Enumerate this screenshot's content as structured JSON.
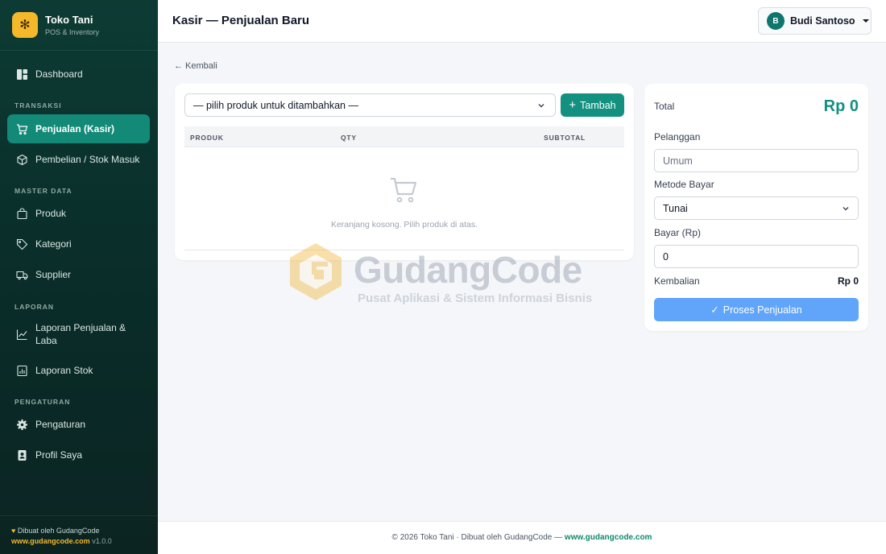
{
  "brand": {
    "name": "Toko Tani",
    "subtitle": "POS & Inventory"
  },
  "sidebar": {
    "dashboard": "Dashboard",
    "sections": {
      "transaksi": "TRANSAKSI",
      "master": "MASTER DATA",
      "laporan": "LAPORAN",
      "pengaturan": "PENGATURAN"
    },
    "items": {
      "penjualan": "Penjualan (Kasir)",
      "pembelian": "Pembelian / Stok Masuk",
      "produk": "Produk",
      "kategori": "Kategori",
      "supplier": "Supplier",
      "laporan_penjualan": "Laporan Penjualan & Laba",
      "laporan_stok": "Laporan Stok",
      "pengaturan": "Pengaturan",
      "profil": "Profil Saya"
    },
    "footer": {
      "made_by": "Dibuat oleh GudangCode",
      "link": "www.gudangcode.com",
      "version": "v1.0.0"
    }
  },
  "header": {
    "title": "Kasir — Penjualan Baru",
    "user_initial": "B",
    "user_name": "Budi Santoso"
  },
  "back_link": "← Kembali",
  "cart": {
    "product_select": "— pilih produk untuk ditambahkan —",
    "add_button": "Tambah",
    "columns": {
      "produk": "PRODUK",
      "qty": "QTY",
      "subtotal": "SUBTOTAL"
    },
    "empty_message": "Keranjang kosong. Pilih produk di atas."
  },
  "summary": {
    "total_label": "Total",
    "total_value": "Rp 0",
    "customer_label": "Pelanggan",
    "customer_placeholder": "Umum",
    "method_label": "Metode Bayar",
    "method_value": "Tunai",
    "pay_label": "Bayar (Rp)",
    "pay_value": "0",
    "change_label": "Kembalian",
    "change_value": "Rp 0",
    "process_button": "Proses Penjualan"
  },
  "watermark": {
    "title": "GudangCode",
    "subtitle": "Pusat Aplikasi & Sistem Informasi Bisnis"
  },
  "footer": {
    "text": "© 2026 Toko Tani · Dibuat oleh GudangCode — ",
    "link": "www.gudangcode.com"
  },
  "colors": {
    "sidebar": "#0d3b34",
    "accent": "#13907f",
    "brand_yellow": "#f5b82a",
    "process_button": "#60a5fa"
  }
}
